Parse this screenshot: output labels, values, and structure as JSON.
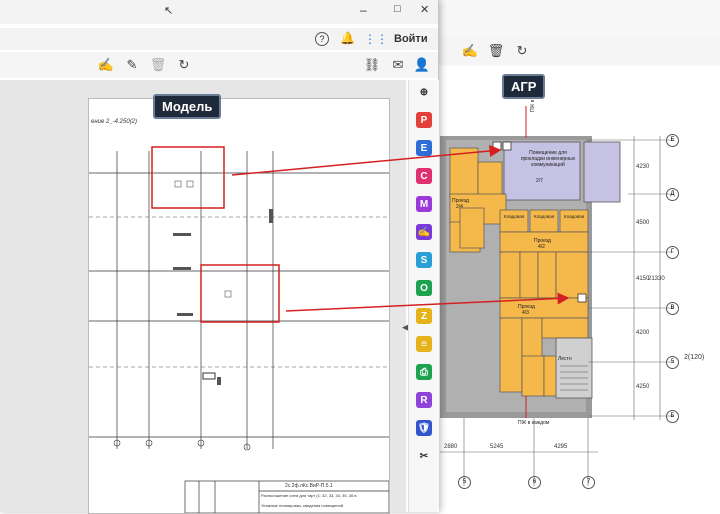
{
  "front": {
    "menu": {
      "signin_label": "Войти",
      "help_icon": "help-circle-icon",
      "bell_icon": "bell-icon",
      "apps_icon": "apps-grid-icon"
    },
    "title_controls": {
      "minimize": "–",
      "maximize": "□",
      "close": "✕"
    },
    "page_note": "ение 2_-4.250(2)",
    "label": "Модель",
    "title_block_code": "2с.2ф.лКс.ВиР-П.5.1",
    "title_block_line1": "Расположение схем для тарт (1: 32, 33, 34, 35, 36 в",
    "title_block_line2": "Этажные планировки, сведения помещений"
  },
  "back": {
    "label": "АГР",
    "rooms": {
      "main": "Помещение для прокладки инженерных коммуникаций",
      "main_num": "2/7",
      "proezd1": "Проезд",
      "proezd1_num": "2/4",
      "proezd2": "Проезд",
      "proezd2_num": "4/2",
      "proezd3": "Проезд",
      "proezd3_num": "4/3",
      "kladovaya": "Кладовая",
      "stairs": "Лестн"
    },
    "notes": {
      "pkk_top": "ПЖ в каждом",
      "pkk_bottom": "ПЖ в каждом"
    },
    "dims_right": [
      "4230",
      "4500",
      "4150",
      "4200",
      "4250"
    ],
    "dim_total": "21330",
    "dims_bottom": [
      "2880",
      "5245",
      "4295"
    ],
    "axis_letters": [
      "Е",
      "Д",
      "Г",
      "В",
      "Б",
      "А"
    ],
    "axis_numbers": [
      "5",
      "6",
      "7"
    ],
    "section_mark": "2(120)",
    "axis_label_5": "5"
  },
  "colors": {
    "room_orange": "#f5b84a",
    "room_lavender": "#c5c2e3",
    "arrow_red": "#d42020",
    "highlight_box": "#d42020"
  }
}
